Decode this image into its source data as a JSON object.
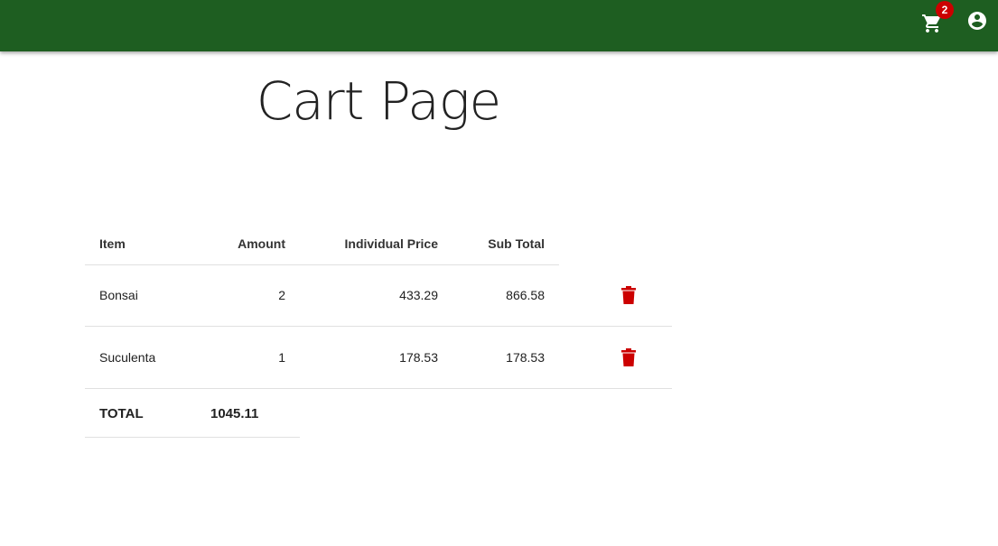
{
  "header": {
    "cart_count": "2",
    "icons": {
      "cart": "shopping-cart-icon",
      "account": "account-circle-icon"
    }
  },
  "page": {
    "title": "Cart Page"
  },
  "table": {
    "columns": [
      "Item",
      "Amount",
      "Individual Price",
      "Sub Total"
    ],
    "rows": [
      {
        "item": "Bonsai",
        "amount": "2",
        "price": "433.29",
        "subtotal": "866.58"
      },
      {
        "item": "Suculenta",
        "amount": "1",
        "price": "178.53",
        "subtotal": "178.53"
      }
    ],
    "total_label": "TOTAL",
    "total_value": "1045.11"
  },
  "colors": {
    "appbar": "#1e5e21",
    "badge": "#cc0000",
    "delete": "#cc0000"
  }
}
